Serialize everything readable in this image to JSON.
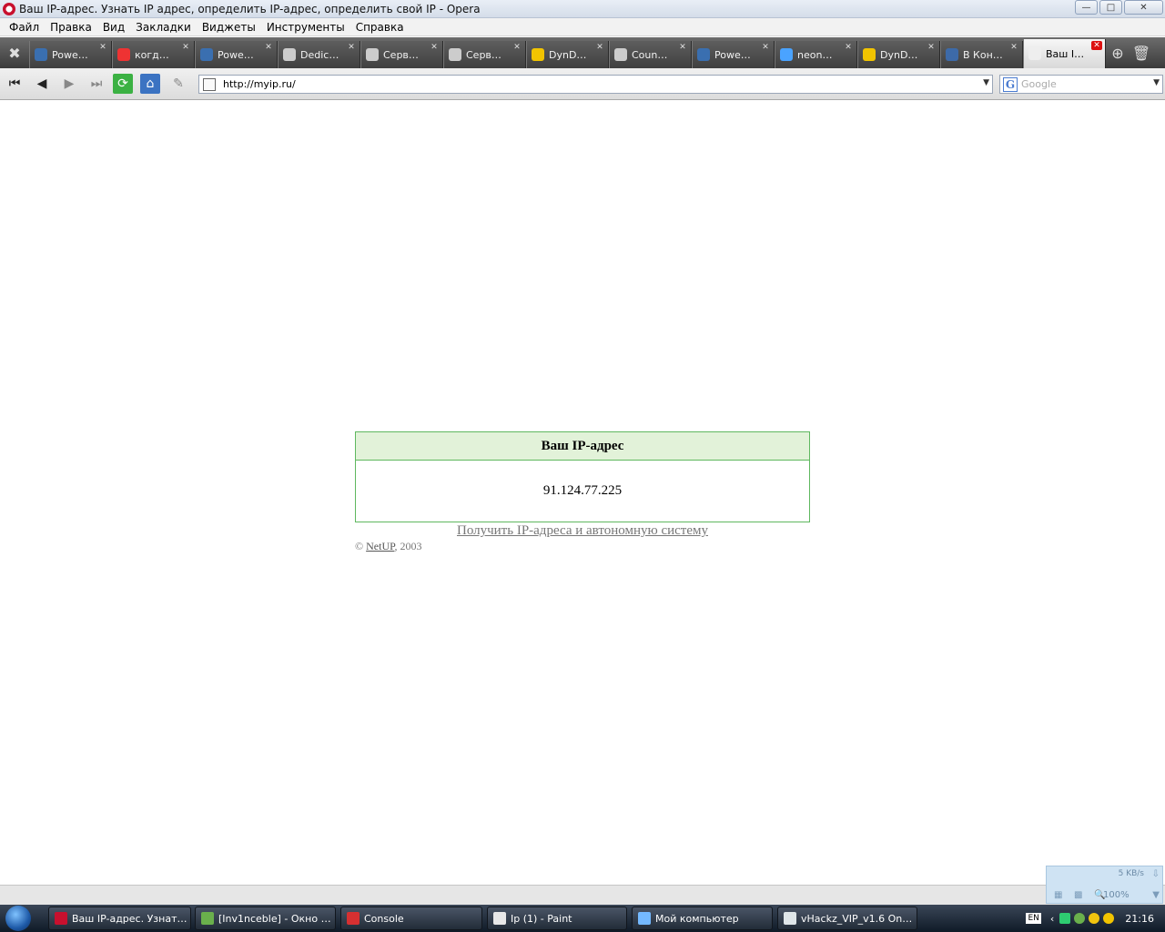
{
  "window": {
    "title": "Ваш IP-адрес. Узнать IP адрес, определить IP-адрес, определить свой IP - Opera"
  },
  "menu": [
    "Файл",
    "Правка",
    "Вид",
    "Закладки",
    "Виджеты",
    "Инструменты",
    "Справка"
  ],
  "tabs": [
    {
      "label": "Powe…",
      "icon": "globe-icon",
      "color": "#3a6fb0"
    },
    {
      "label": "когд…",
      "icon": "google-icon",
      "color": "#e33"
    },
    {
      "label": "Powe…",
      "icon": "globe-icon",
      "color": "#3a6fb0"
    },
    {
      "label": "Dedic…",
      "icon": "counterstrike-icon",
      "color": "#ccc"
    },
    {
      "label": "Серв…",
      "icon": "counterstrike-icon",
      "color": "#ccc"
    },
    {
      "label": "Серв…",
      "icon": "counterstrike-icon",
      "color": "#ccc"
    },
    {
      "label": "DynD…",
      "icon": "moon-icon",
      "color": "#f2c400"
    },
    {
      "label": "Coun…",
      "icon": "counterstrike-icon",
      "color": "#ccc"
    },
    {
      "label": "Powe…",
      "icon": "globe-icon",
      "color": "#3a6fb0"
    },
    {
      "label": "neon…",
      "icon": "at-icon",
      "color": "#4aa3ff"
    },
    {
      "label": "DynD…",
      "icon": "moon-icon",
      "color": "#f2c400"
    },
    {
      "label": "В Кон…",
      "icon": "vk-icon",
      "color": "#3d6aa8"
    },
    {
      "label": "Ваш I…",
      "icon": "page-icon",
      "color": "#eee",
      "active": true
    }
  ],
  "nav": {
    "url": "http://myip.ru/",
    "search_placeholder": "Google"
  },
  "page": {
    "box_header": "Ваш IP-адрес",
    "ip": "91.124.77.225",
    "link": "Получить IP-адреса и автономную систему",
    "copyright_prefix": "© ",
    "copyright_owner": "NetUP",
    "copyright_year": ", 2003"
  },
  "transfer": {
    "speed": "5 KB/s",
    "zoom": "100%"
  },
  "taskbar": {
    "items": [
      {
        "label": "Ваш IP-адрес. Узнат…",
        "color": "#c8102e"
      },
      {
        "label": "[Inv1nceble] - Окно …",
        "color": "#6ab04c"
      },
      {
        "label": "Console",
        "color": "#d63031"
      },
      {
        "label": "Ip (1) - Paint",
        "color": "#e8e8e8"
      },
      {
        "label": "Мой компьютер",
        "color": "#74b9ff"
      },
      {
        "label": "vHackz_VIP_v1.6 On…",
        "color": "#dfe6e9"
      }
    ],
    "lang": "EN",
    "clock": "21:16"
  }
}
